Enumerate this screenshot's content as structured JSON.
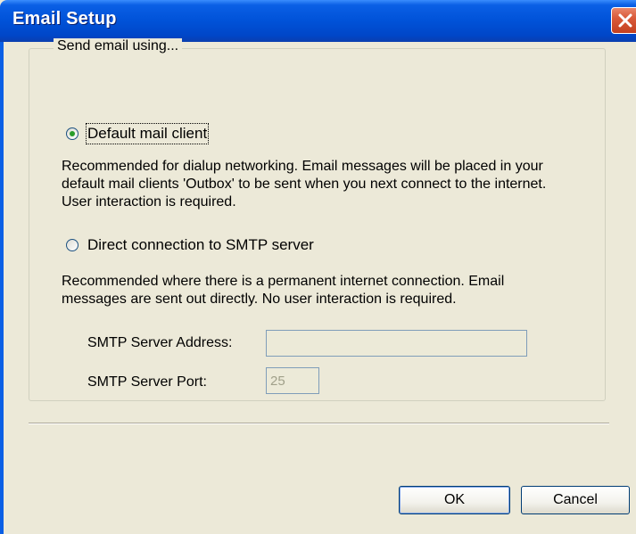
{
  "window": {
    "title": "Email Setup"
  },
  "group": {
    "legend": "Send email using..."
  },
  "options": {
    "default_client": {
      "label": "Default mail client",
      "selected": true,
      "description_lines": [
        "Recommended for dialup networking. Email messages will be placed in your",
        "default mail clients 'Outbox' to be sent when you next connect to the internet.",
        "User interaction is required."
      ]
    },
    "smtp": {
      "label": "Direct connection to SMTP server",
      "selected": false,
      "description_lines": [
        "Recommended where there is a permanent internet connection. Email",
        "messages are sent out directly. No user interaction is required."
      ]
    }
  },
  "smtp_settings": {
    "address_label": "SMTP Server Address:",
    "address_value": "",
    "port_label": "SMTP Server Port:",
    "port_value": "25"
  },
  "buttons": {
    "ok": "OK",
    "cancel": "Cancel"
  },
  "colors": {
    "titlebar": "#0052d8",
    "dialog_bg": "#ece9d8",
    "close_button": "#d95a3a"
  },
  "icons": {
    "close": "close-icon"
  }
}
